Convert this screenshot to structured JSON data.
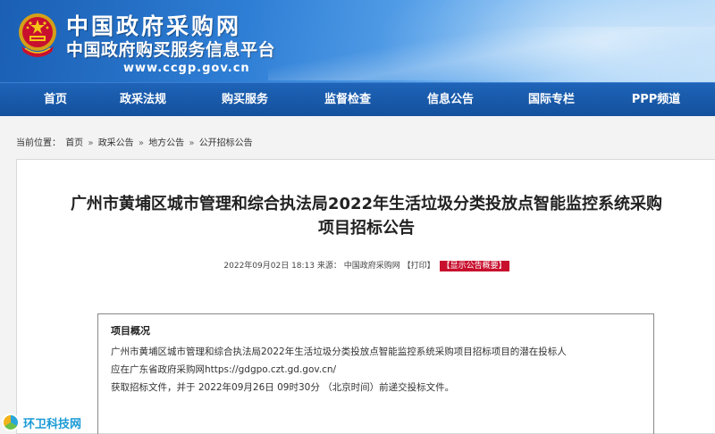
{
  "header": {
    "site_name": "中国政府采购网",
    "site_subtitle": "中国政府购买服务信息平台",
    "site_url": "www.ccgp.gov.cn",
    "emblem_icon": "national-emblem-icon"
  },
  "nav": {
    "items": [
      {
        "label": "首页"
      },
      {
        "label": "政采法规"
      },
      {
        "label": "购买服务"
      },
      {
        "label": "监督检查"
      },
      {
        "label": "信息公告"
      },
      {
        "label": "国际专栏"
      },
      {
        "label": "PPP频道"
      }
    ]
  },
  "breadcrumb": {
    "prefix": "当前位置：",
    "items": [
      "首页",
      "政采公告",
      "地方公告",
      "公开招标公告"
    ],
    "separator": "»"
  },
  "article": {
    "title_line1": "广州市黄埔区城市管理和综合执法局2022年生活垃圾分类投放点智能监控系统采购",
    "title_line2": "项目招标公告",
    "datetime": "2022年09月02日 18:13",
    "source_label": "来源：",
    "source": "中国政府采购网",
    "print_label": "【打印】",
    "show_label": "【显示公告概要】"
  },
  "overview": {
    "heading": "项目概况",
    "line1": "广州市黄埔区城市管理和综合执法局2022年生活垃圾分类投放点智能监控系统采购项目招标项目的潜在投标人",
    "line2": "应在广东省政府采购网https://gdgpo.czt.gd.gov.cn/",
    "line3": "获取招标文件，并于 2022年09月26日 09时30分 （北京时间）前递交投标文件。"
  },
  "watermark": {
    "text": "环卫科技网"
  },
  "colors": {
    "nav_bg": "#1a5aa8",
    "badge_red": "#c8102e",
    "banner_blue": "#2f7fd6"
  }
}
